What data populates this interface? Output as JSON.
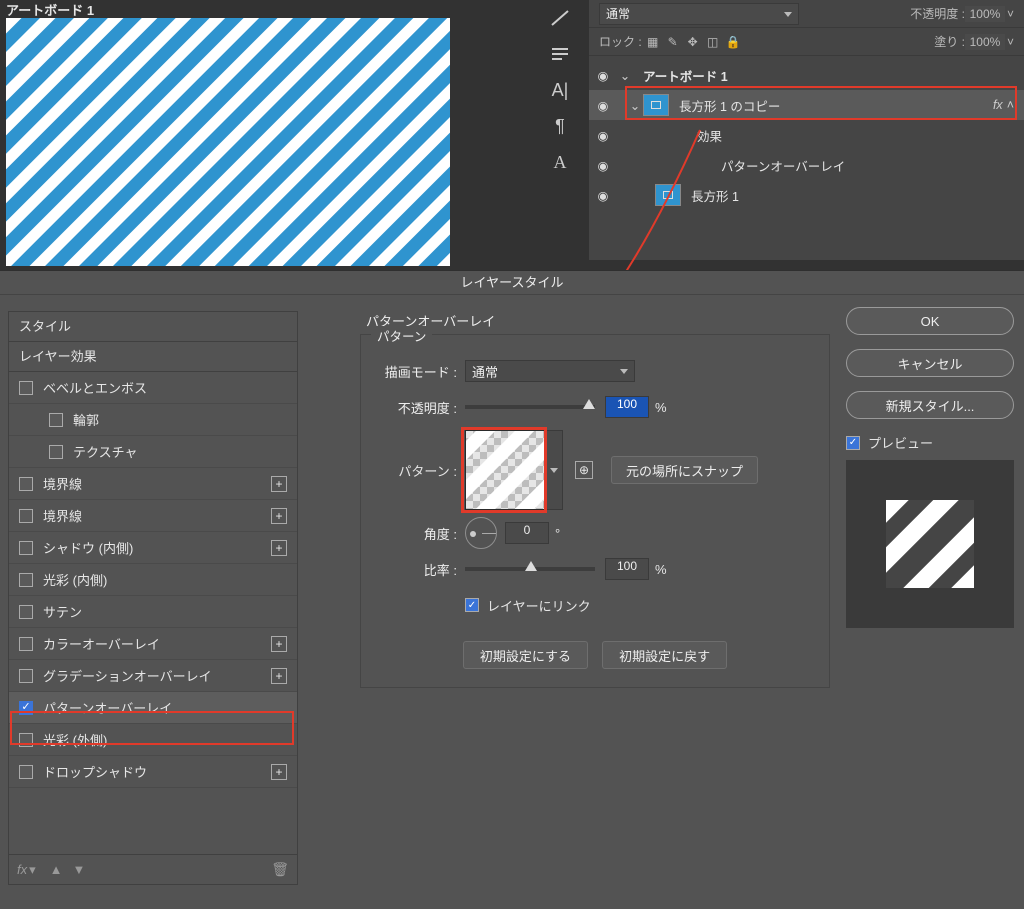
{
  "artboard": {
    "label": "アートボード 1"
  },
  "layers_panel": {
    "blend": "通常",
    "opacity_label": "不透明度",
    "opacity_value": "100%",
    "lock_label": "ロック",
    "fill_label": "塗り",
    "fill_value": "100%",
    "items": [
      {
        "name": "アートボード 1"
      },
      {
        "name": "長方形 1 のコピー",
        "fx": "fx"
      },
      {
        "name": "効果"
      },
      {
        "name": "パターンオーバーレイ"
      },
      {
        "name": "長方形 1"
      }
    ]
  },
  "dialog": {
    "title": "レイヤースタイル",
    "styles_header": "スタイル",
    "effects_header": "レイヤー効果",
    "items": [
      {
        "label": "ベベルとエンボス",
        "checked": false
      },
      {
        "label": "輪郭",
        "checked": false,
        "indent": true
      },
      {
        "label": "テクスチャ",
        "checked": false,
        "indent": true
      },
      {
        "label": "境界線",
        "checked": false,
        "plus": true
      },
      {
        "label": "境界線",
        "checked": false,
        "plus": true
      },
      {
        "label": "シャドウ (内側)",
        "checked": false,
        "plus": true
      },
      {
        "label": "光彩 (内側)",
        "checked": false
      },
      {
        "label": "サテン",
        "checked": false
      },
      {
        "label": "カラーオーバーレイ",
        "checked": false,
        "plus": true
      },
      {
        "label": "グラデーションオーバーレイ",
        "checked": false,
        "plus": true
      },
      {
        "label": "パターンオーバーレイ",
        "checked": true,
        "selected": true
      },
      {
        "label": "光彩 (外側)",
        "checked": false
      },
      {
        "label": "ドロップシャドウ",
        "checked": false,
        "plus": true
      }
    ],
    "footer_fx": "fx",
    "center": {
      "section_title": "パターンオーバーレイ",
      "group_legend": "パターン",
      "blend_label": "描画モード :",
      "blend_value": "通常",
      "opacity_label": "不透明度 :",
      "opacity_value": "100",
      "pattern_label": "パターン :",
      "snap_btn": "元の場所にスナップ",
      "angle_label": "角度 :",
      "angle_value": "0",
      "scale_label": "比率 :",
      "scale_value": "100",
      "link_label": "レイヤーにリンク",
      "default_set": "初期設定にする",
      "default_reset": "初期設定に戻す"
    },
    "right": {
      "ok": "OK",
      "cancel": "キャンセル",
      "new_style": "新規スタイル...",
      "preview": "プレビュー"
    }
  }
}
